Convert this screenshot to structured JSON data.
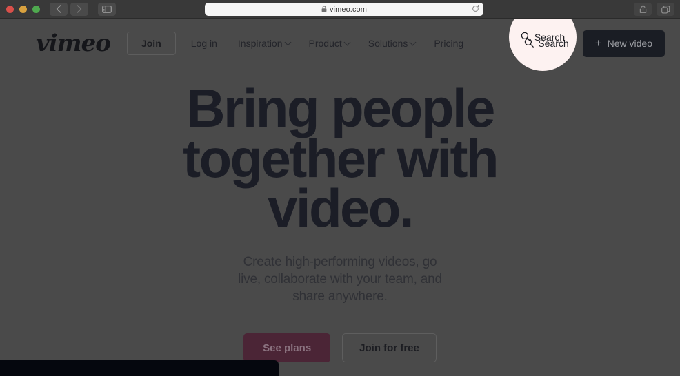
{
  "browser": {
    "traffic_lights": [
      {
        "name": "close",
        "color": "#d9504a"
      },
      {
        "name": "minimize",
        "color": "#d9a23f"
      },
      {
        "name": "zoom",
        "color": "#4fa94f"
      }
    ],
    "back_icon": "chevron-left-icon",
    "forward_icon": "chevron-right-icon",
    "sidebar_icon": "sidebar-toggle-icon",
    "extension_icon": "extension-icon",
    "url": "vimeo.com",
    "url_lock_icon": "lock-icon",
    "reload_icon": "reload-icon",
    "share_icon": "share-icon",
    "tabs_icon": "tabs-icon"
  },
  "site": {
    "logo_text": "vimeo",
    "join_label": "Join",
    "login_label": "Log in",
    "nav": [
      {
        "label": "Inspiration",
        "has_caret": true
      },
      {
        "label": "Product",
        "has_caret": true
      },
      {
        "label": "Solutions",
        "has_caret": true
      },
      {
        "label": "Pricing",
        "has_caret": false
      }
    ],
    "search_label": "Search",
    "search_icon": "search-icon",
    "new_video_label": "New video",
    "new_video_plus": "+"
  },
  "hero": {
    "title": "Bring people together with video.",
    "subtitle": "Create high-performing videos, go live, collaborate with your team, and share anywhere.",
    "primary_cta": "See plans",
    "secondary_cta": "Join for free"
  },
  "colors": {
    "page_overlay": "#4a4a4a",
    "headline": "#1b1d26",
    "primary_button": "#4b2536",
    "new_video_button": "#1a1d24",
    "spotlight": "#fdf2f1",
    "bottom_block": "#05070e"
  }
}
